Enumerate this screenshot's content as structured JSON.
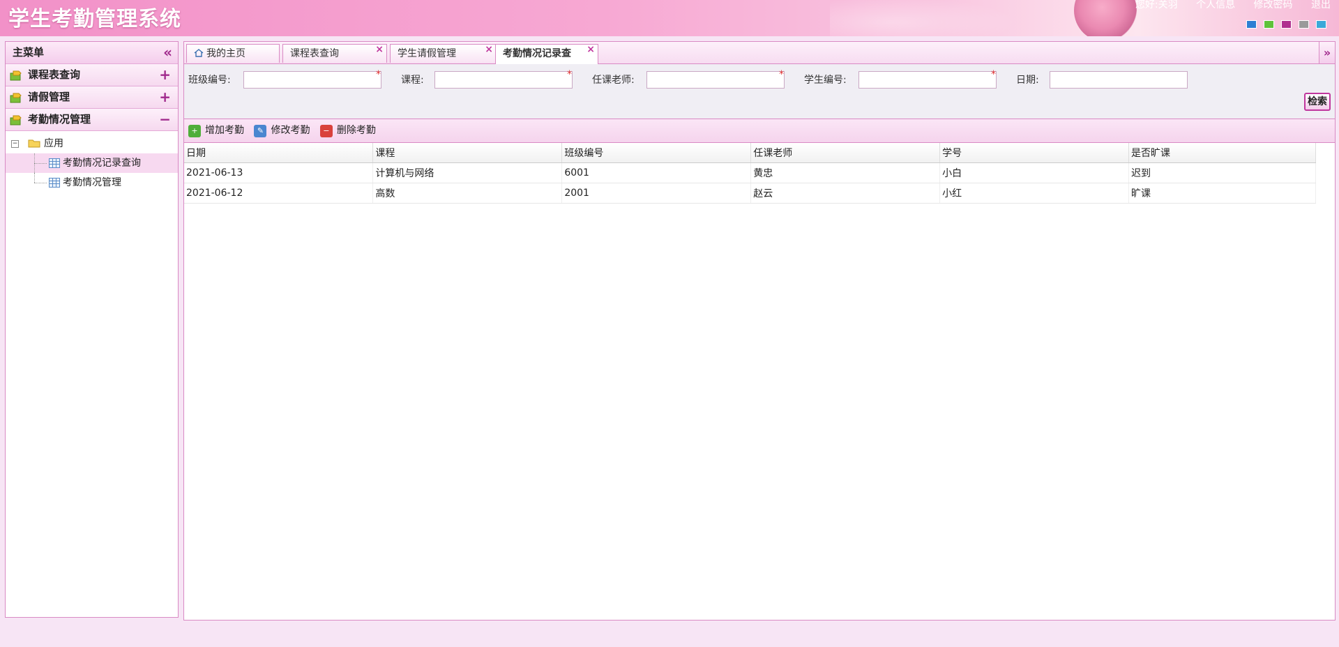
{
  "header": {
    "title": "学生考勤管理系统",
    "links": [
      "您好:关羽",
      "个人信息",
      "修改密码",
      "退出"
    ],
    "theme_colors": [
      "#2d7fd3",
      "#5fc23a",
      "#b0308f",
      "#9a9a9a",
      "#3aa8d8"
    ]
  },
  "sidebar": {
    "title": "主菜单",
    "accordion": [
      {
        "label": "课程表查询",
        "toggle": "+"
      },
      {
        "label": "请假管理",
        "toggle": "+"
      },
      {
        "label": "考勤情况管理",
        "toggle": "−"
      }
    ],
    "tree": {
      "root": "应用",
      "children": [
        "考勤情况记录查询",
        "考勤情况管理"
      ]
    }
  },
  "tabs": [
    {
      "label": "我的主页"
    },
    {
      "label": "课程表查询"
    },
    {
      "label": "学生请假管理"
    },
    {
      "label": "考勤情况记录查"
    }
  ],
  "search": {
    "fields": [
      {
        "label": "班级编号:",
        "value": ""
      },
      {
        "label": "课程:",
        "value": ""
      },
      {
        "label": "任课老师:",
        "value": ""
      },
      {
        "label": "学生编号:",
        "value": ""
      },
      {
        "label": "日期:",
        "value": ""
      }
    ],
    "button": "检索"
  },
  "toolbar": {
    "add": "增加考勤",
    "edit": "修改考勤",
    "delete": "删除考勤"
  },
  "table": {
    "columns": [
      "日期",
      "课程",
      "班级编号",
      "任课老师",
      "学号",
      "是否旷课"
    ],
    "rows": [
      [
        "2021-06-13",
        "计算机与网络",
        "6001",
        "黄忠",
        "小白",
        "迟到"
      ],
      [
        "2021-06-12",
        "高数",
        "2001",
        "赵云",
        "小红",
        "旷课"
      ]
    ]
  }
}
